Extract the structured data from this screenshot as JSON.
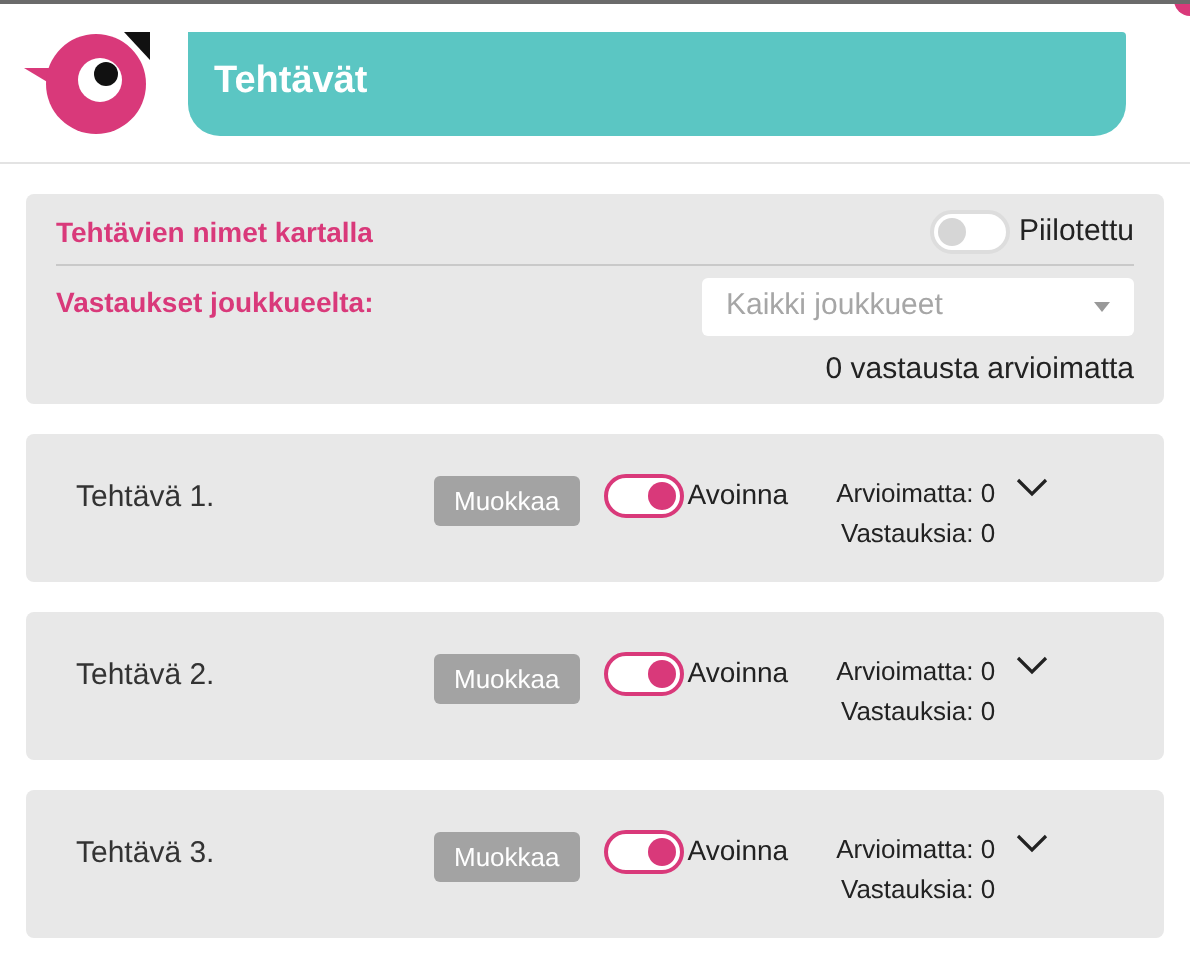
{
  "header": {
    "title": "Tehtävät"
  },
  "filters": {
    "names_label": "Tehtävien nimet kartalla",
    "names_toggle": {
      "on": false,
      "label": "Piilotettu"
    },
    "team_label": "Vastaukset joukkueelta:",
    "team_select": {
      "placeholder": "Kaikki joukkueet"
    },
    "summary": "0 vastausta arvioimatta"
  },
  "tasks": [
    {
      "name": "Tehtävä 1.",
      "edit": "Muokkaa",
      "open": true,
      "status": "Avoinna",
      "unreviewed": "Arvioimatta: 0",
      "answers": "Vastauksia: 0"
    },
    {
      "name": "Tehtävä 2.",
      "edit": "Muokkaa",
      "open": true,
      "status": "Avoinna",
      "unreviewed": "Arvioimatta: 0",
      "answers": "Vastauksia: 0"
    },
    {
      "name": "Tehtävä 3.",
      "edit": "Muokkaa",
      "open": true,
      "status": "Avoinna",
      "unreviewed": "Arvioimatta: 0",
      "answers": "Vastauksia: 0"
    }
  ]
}
